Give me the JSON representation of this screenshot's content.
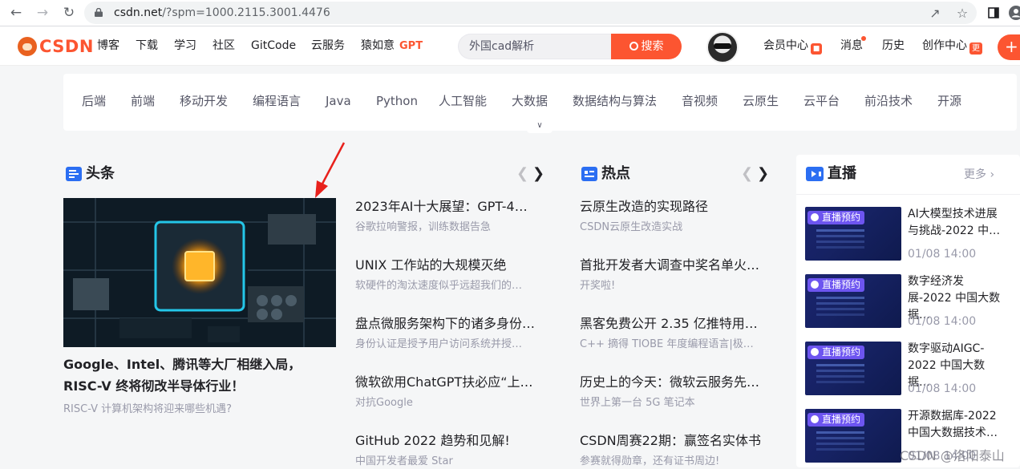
{
  "browser": {
    "url_host": "csdn.net",
    "url_path": "/?spm=1000.2115.3001.4476"
  },
  "header": {
    "logo_text": "CSDN",
    "nav": [
      "博客",
      "下载",
      "学习",
      "社区",
      "GitCode",
      "云服务",
      "猿如意"
    ],
    "gpt_label": "GPT",
    "search_placeholder": "外国cad解析",
    "search_button": "搜索",
    "user_nav": {
      "member": "会员中心",
      "messages": "消息",
      "history": "历史",
      "creator": "创作中心",
      "creator_badge": "更"
    }
  },
  "categories": [
    "后端",
    "前端",
    "移动开发",
    "编程语言",
    "Java",
    "Python",
    "人工智能",
    "大数据",
    "数据结构与算法",
    "音视频",
    "云原生",
    "云平台",
    "前沿技术",
    "开源"
  ],
  "headlines": {
    "title": "头条",
    "feature": {
      "title": "Google、Intel、腾讯等大厂相继入局，RISC-V 终将彻改半导体行业！",
      "desc": "RISC-V 计算机架构将迎来哪些机遇?"
    },
    "items": [
      {
        "title": "2023年AI十大展望：GPT-4领…",
        "desc": "谷歌拉响警报，训练数据告急"
      },
      {
        "title": "UNIX 工作站的大规模灭绝",
        "desc": "软硬件的淘汰速度似乎远超我们的…"
      },
      {
        "title": "盘点微服务架构下的诸多身份…",
        "desc": "身份认证是授予用户访问系统并授…"
      },
      {
        "title": "微软欲用ChatGPT扶必应“上位”",
        "desc": "对抗Google"
      },
      {
        "title": "GitHub 2022 趋势和见解!",
        "desc": "中国开发者最爱 Star"
      }
    ]
  },
  "hot": {
    "title": "热点",
    "items": [
      {
        "title": "云原生改造的实现路径",
        "desc": "CSDN云原生改造实战"
      },
      {
        "title": "首批开发者大调查中奖名单火…",
        "desc": "开奖啦!"
      },
      {
        "title": "黑客免费公开 2.35 亿推特用…",
        "desc": "C++ 摘得 TIOBE 年度编程语言|极…"
      },
      {
        "title": "历史上的今天：微软云服务先…",
        "desc": "世界上第一台 5G 笔记本"
      },
      {
        "title": "CSDN周赛22期：赢签名实体书",
        "desc": "参赛就得勋章，还有证书周边!"
      }
    ]
  },
  "live": {
    "title": "直播",
    "more": "更多",
    "tag_label": "直播预约",
    "items": [
      {
        "title": "AI大模型技术进展与挑战-2022 中…",
        "time": "01/08 14:00"
      },
      {
        "title": "数字经济发展-2022 中国大数据…",
        "time": "01/08 14:00"
      },
      {
        "title": "数字驱动AIGC-2022 中国大数据…",
        "time": "01/08 14:00"
      },
      {
        "title": "开源数据库-2022 中国大数据技术…",
        "time": "01/08 14:00"
      }
    ]
  },
  "watermark": "CSDN @洛阳泰山",
  "colors": {
    "accent": "#fc5531",
    "icon_blue": "#2b6ef2",
    "annotation_red": "#e8211c"
  }
}
